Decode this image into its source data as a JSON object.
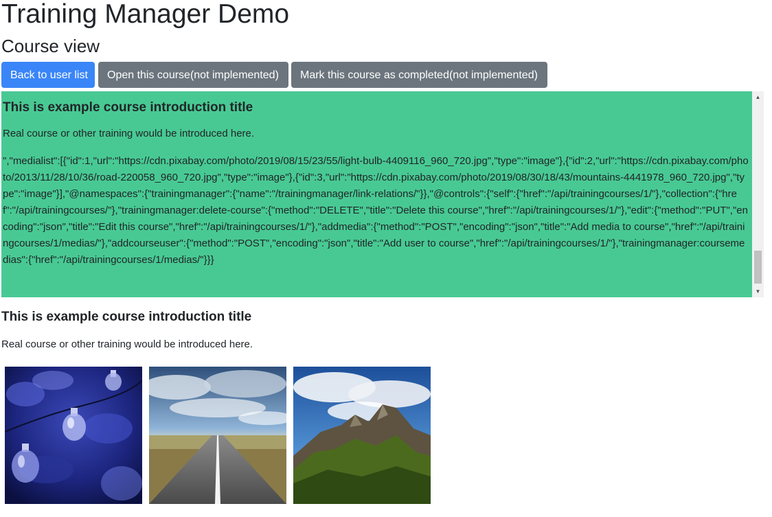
{
  "app": {
    "title": "Training Manager Demo",
    "view_title": "Course view"
  },
  "toolbar": {
    "back_label": "Back to user list",
    "open_label": "Open this course(not implemented)",
    "complete_label": "Mark this course as completed(not implemented)"
  },
  "intro_box": {
    "title": "This is example course introduction title",
    "text": "Real course or other training would be introduced here.",
    "raw": "\",\"medialist\":[{\"id\":1,\"url\":\"https://cdn.pixabay.com/photo/2019/08/15/23/55/light-bulb-4409116_960_720.jpg\",\"type\":\"image\"},{\"id\":2,\"url\":\"https://cdn.pixabay.com/photo/2013/11/28/10/36/road-220058_960_720.jpg\",\"type\":\"image\"},{\"id\":3,\"url\":\"https://cdn.pixabay.com/photo/2019/08/30/18/43/mountains-4441978_960_720.jpg\",\"type\":\"image\"}],\"@namespaces\":{\"trainingmanager\":{\"name\":\"/trainingmanager/link-relations/\"}},\"@controls\":{\"self\":{\"href\":\"/api/trainingcourses/1/\"},\"collection\":{\"href\":\"/api/trainingcourses/\"},\"trainingmanager:delete-course\":{\"method\":\"DELETE\",\"title\":\"Delete this course\",\"href\":\"/api/trainingcourses/1/\"},\"edit\":{\"method\":\"PUT\",\"encoding\":\"json\",\"title\":\"Edit this course\",\"href\":\"/api/trainingcourses/1/\"},\"addmedia\":{\"method\":\"POST\",\"encoding\":\"json\",\"title\":\"Add media to course\",\"href\":\"/api/trainingcourses/1/medias/\"},\"addcourseuser\":{\"method\":\"POST\",\"encoding\":\"json\",\"title\":\"Add user to course\",\"href\":\"/api/trainingcourses/1/\"},\"trainingmanager:coursemedias\":{\"href\":\"/api/trainingcourses/1/medias/\"}}}"
  },
  "course": {
    "title": "This is example course introduction title",
    "text": "Real course or other training would be introduced here."
  },
  "colors": {
    "primary": "#3a86f8",
    "secondary": "#6c757d",
    "intro_background": "#48c993"
  },
  "media": [
    {
      "icon": "light-bulb-image"
    },
    {
      "icon": "road-image"
    },
    {
      "icon": "mountains-image"
    }
  ]
}
